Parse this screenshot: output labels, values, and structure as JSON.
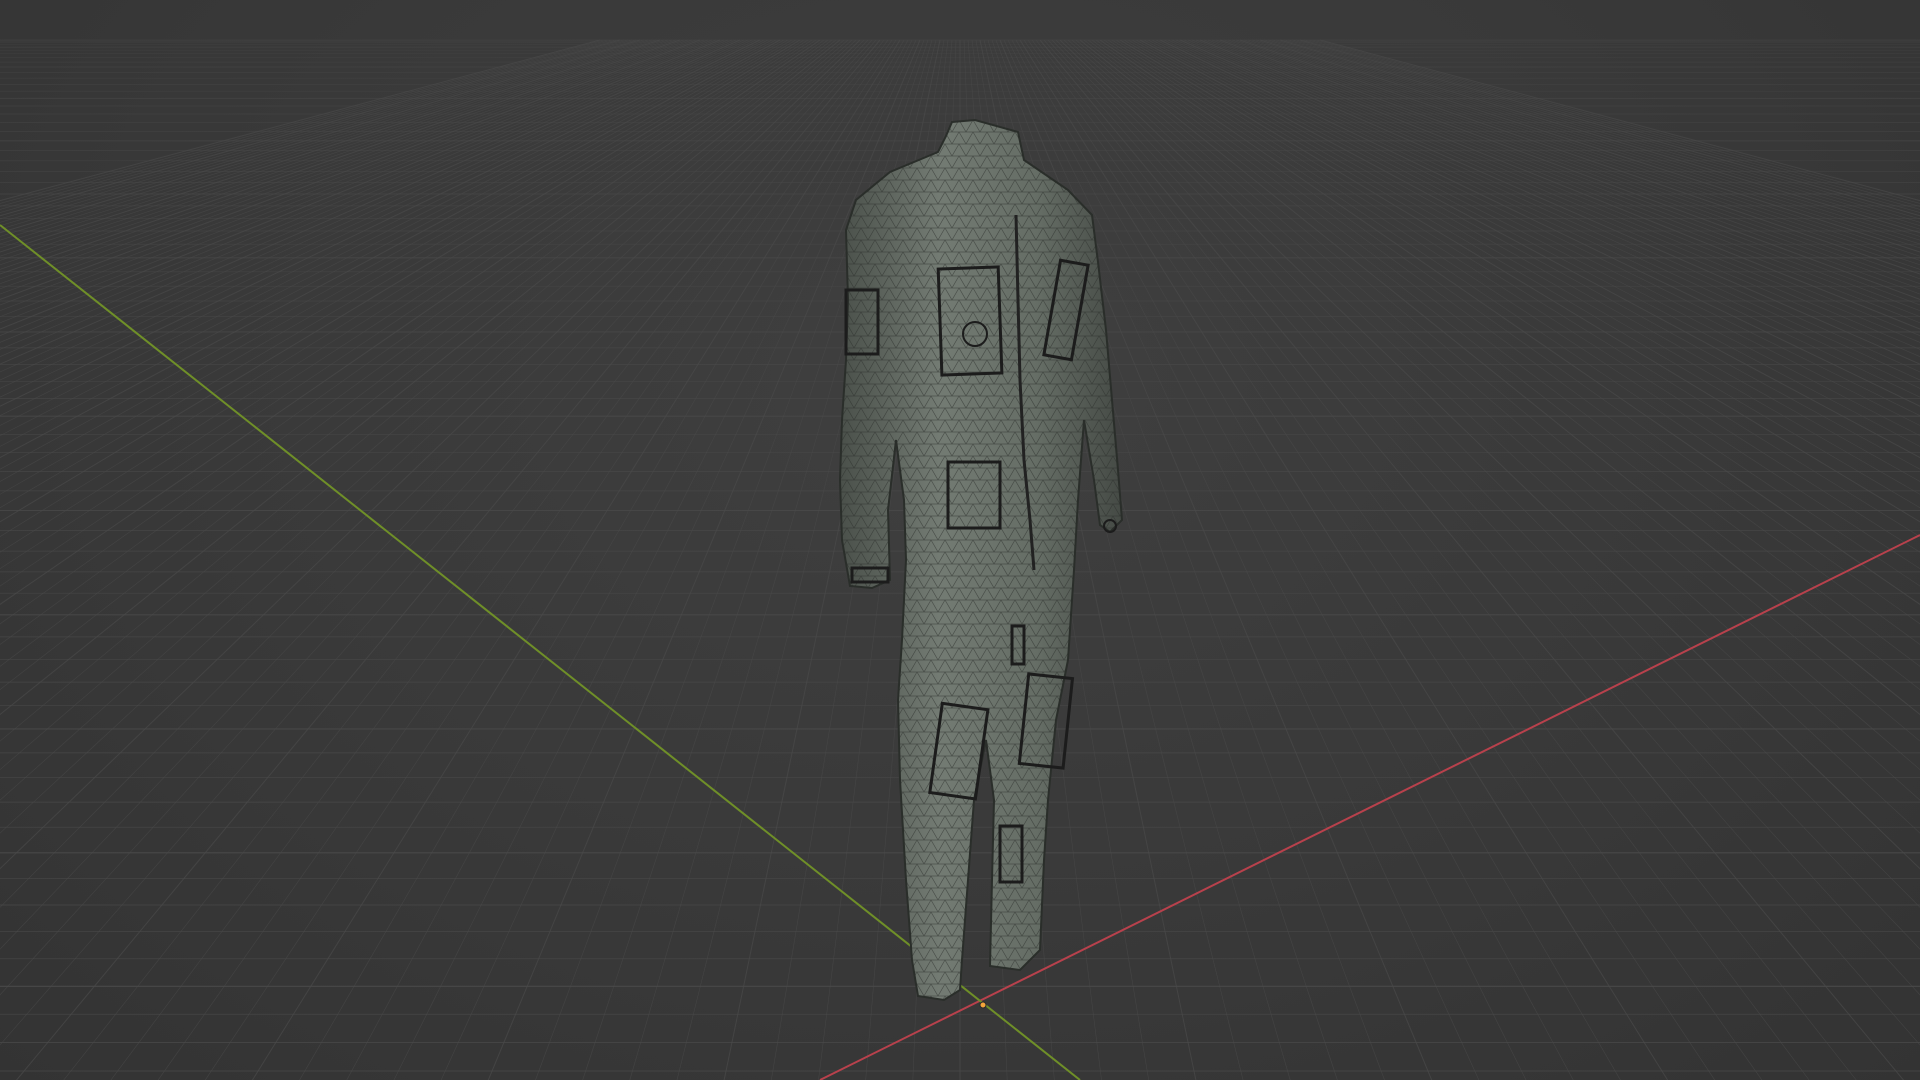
{
  "viewport": {
    "mode": "solid-wireframe",
    "colors": {
      "background": "#3a3a3a",
      "grid_line": "#4a4a4a",
      "grid_major": "#505050",
      "x_axis": "#c0434f",
      "y_axis": "#7a9a2a",
      "origin": "#f4a53b",
      "mesh_fill": "#6e766e",
      "mesh_shade": "#4f554f",
      "mesh_wire": "#262626"
    },
    "object": {
      "kind": "jumpsuit-mesh"
    }
  }
}
